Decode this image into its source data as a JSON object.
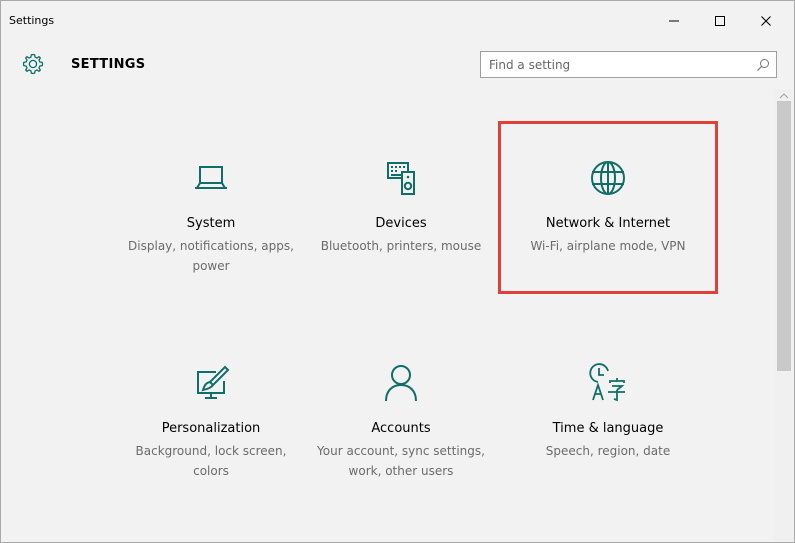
{
  "window": {
    "title": "Settings",
    "controls": [
      "minimize",
      "maximize",
      "close"
    ]
  },
  "header": {
    "title": "SETTINGS",
    "icon": "gear-icon",
    "search": {
      "placeholder": "Find a setting",
      "value": ""
    }
  },
  "tiles": [
    {
      "id": "system",
      "icon": "laptop-icon",
      "title": "System",
      "desc": "Display, notifications, apps, power"
    },
    {
      "id": "devices",
      "icon": "devices-icon",
      "title": "Devices",
      "desc": "Bluetooth, printers, mouse"
    },
    {
      "id": "network",
      "icon": "globe-icon",
      "title": "Network & Internet",
      "desc": "Wi-Fi, airplane mode, VPN"
    },
    {
      "id": "personalization",
      "icon": "paintbrush-monitor-icon",
      "title": "Personalization",
      "desc": "Background, lock screen, colors"
    },
    {
      "id": "accounts",
      "icon": "person-icon",
      "title": "Accounts",
      "desc": "Your account, sync settings, work, other users"
    },
    {
      "id": "time",
      "icon": "time-language-icon",
      "title": "Time & language",
      "desc": "Speech, region, date"
    }
  ],
  "colors": {
    "accent": "#0f6e68",
    "highlight": "#e0403a",
    "background": "#f2f2f2",
    "secondary_text": "#6b6b6b"
  }
}
